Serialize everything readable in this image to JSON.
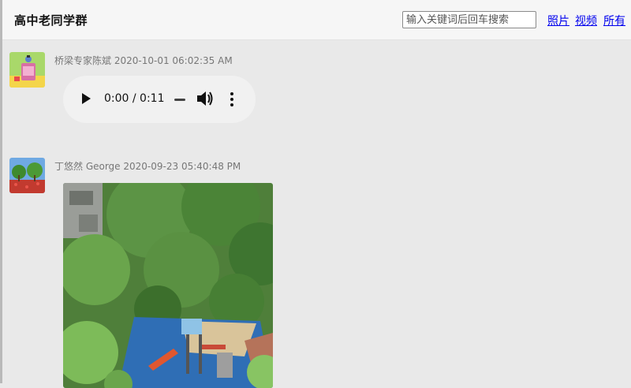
{
  "header": {
    "title": "高中老同学群",
    "search_placeholder": "输入关键词后回车搜索",
    "nav": {
      "photos": "照片",
      "videos": "视频",
      "all": "所有"
    }
  },
  "posts": [
    {
      "author": "桥梁专家陈斌",
      "timestamp": "2020-10-01 06:02:35 AM",
      "attachment": "audio",
      "audio": {
        "time": "0:00 / 0:11",
        "progress": 0.0
      }
    },
    {
      "author": "丁悠然 George",
      "timestamp": "2020-09-23 05:40:48 PM",
      "attachment": "photo"
    }
  ],
  "icons": {
    "play": "play-icon",
    "volume": "volume-icon",
    "more": "more-vertical-icon"
  }
}
